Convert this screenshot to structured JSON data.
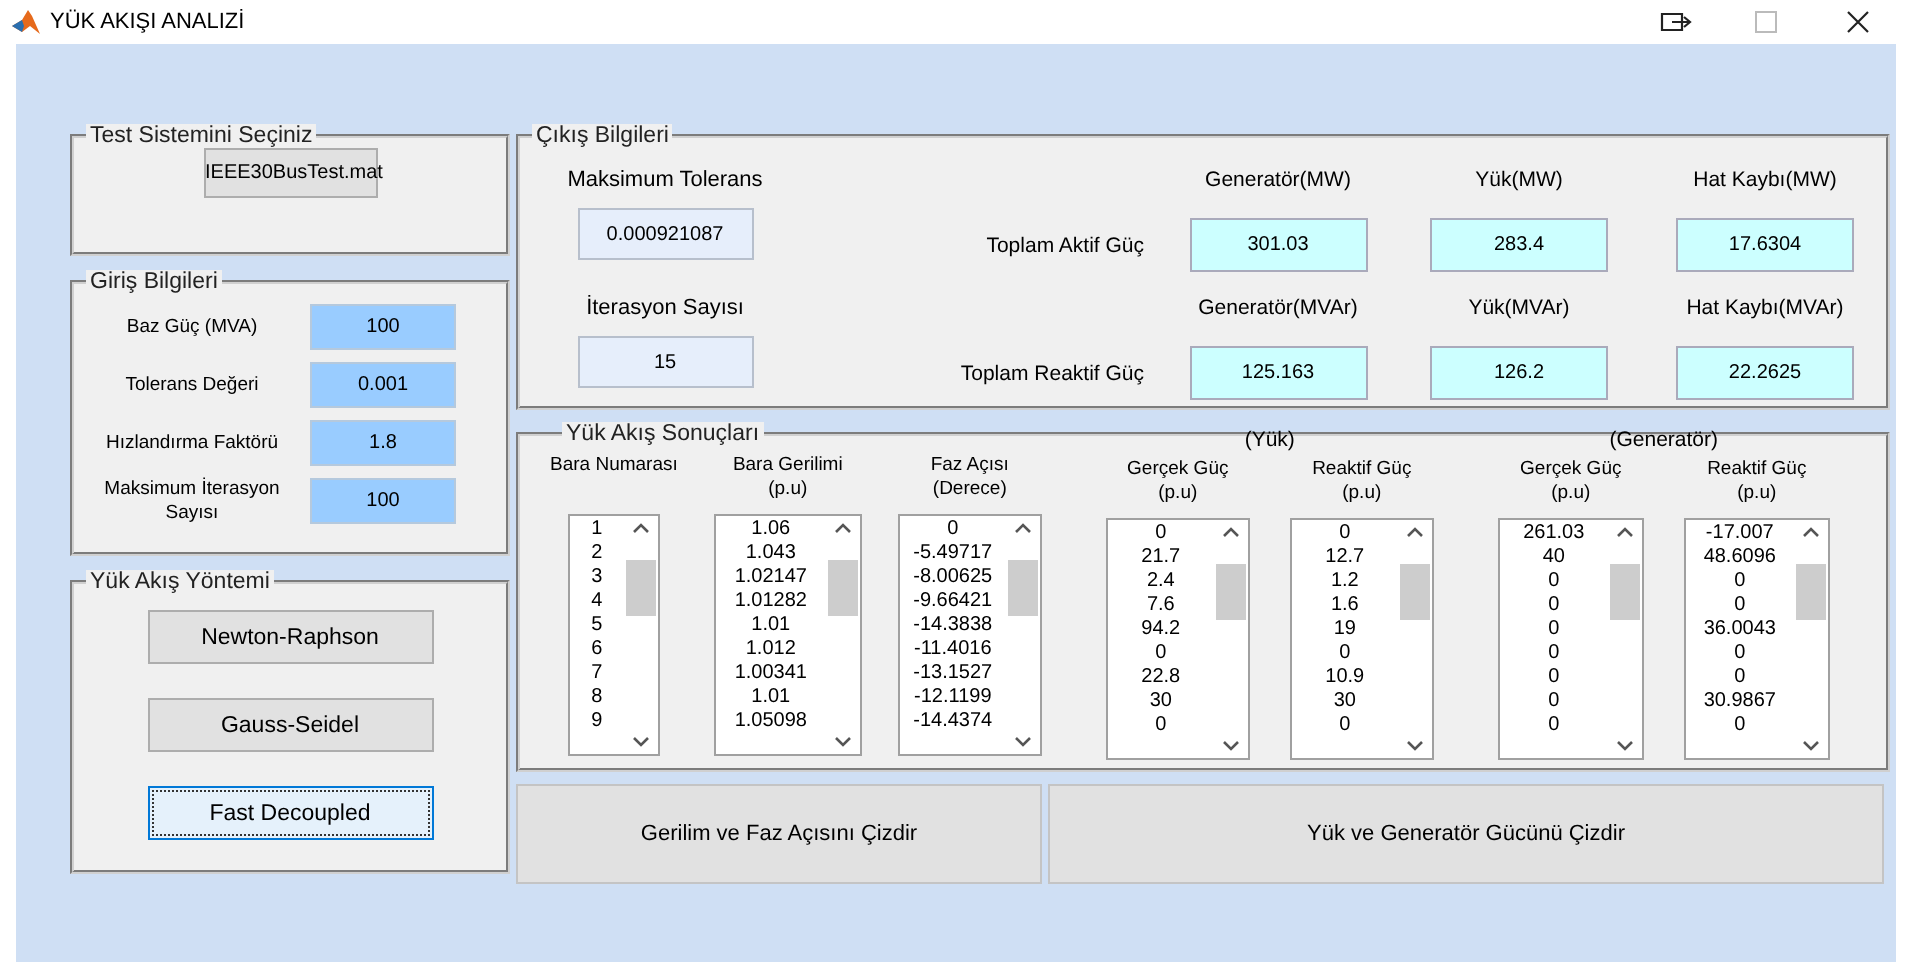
{
  "window": {
    "title": "YÜK AKIŞI ANALIZİ"
  },
  "test_system": {
    "title": "Test Sistemini Seçiniz",
    "button": "IEEE30BusTest.mat"
  },
  "inputs": {
    "title": "Giriş Bilgileri",
    "fields": [
      {
        "label": "Baz Güç (MVA)",
        "value": "100"
      },
      {
        "label": "Tolerans Değeri",
        "value": "0.001"
      },
      {
        "label": "Hızlandırma Faktörü",
        "value": "1.8"
      },
      {
        "label": "Maksimum İterasyon Sayısı",
        "value": "100"
      }
    ]
  },
  "method": {
    "title": "Yük Akış Yöntemi",
    "options": [
      {
        "label": "Newton-Raphson",
        "selected": false
      },
      {
        "label": "Gauss-Seidel",
        "selected": false
      },
      {
        "label": "Fast Decoupled",
        "selected": true
      }
    ]
  },
  "output": {
    "title": "Çıkış Bilgileri",
    "summary": [
      {
        "label": "Maksimum Tolerans",
        "value": "0.000921087"
      },
      {
        "label": "İterasyon Sayısı",
        "value": "15"
      }
    ],
    "rows": [
      {
        "label": "Toplam Aktif Güç",
        "cells": [
          {
            "header": "Generatör(MW)",
            "value": "301.03"
          },
          {
            "header": "Yük(MW)",
            "value": "283.4"
          },
          {
            "header": "Hat Kaybı(MW)",
            "value": "17.6304"
          }
        ]
      },
      {
        "label": "Toplam Reaktif Güç",
        "cells": [
          {
            "header": "Generatör(MVAr)",
            "value": "125.163"
          },
          {
            "header": "Yük(MVAr)",
            "value": "126.2"
          },
          {
            "header": "Hat Kaybı(MVAr)",
            "value": "22.2625"
          }
        ]
      }
    ]
  },
  "results": {
    "title": "Yük Akış Sonuçları",
    "sections": [
      {
        "lists": [
          {
            "header": "Bara Numarası",
            "values": [
              "1",
              "2",
              "3",
              "4",
              "5",
              "6",
              "7",
              "8",
              "9"
            ]
          },
          {
            "header": "Bara Gerilimi",
            "unit": "(p.u)",
            "values": [
              "1.06",
              "1.043",
              "1.02147",
              "1.01282",
              "1.01",
              "1.012",
              "1.00341",
              "1.01",
              "1.05098"
            ]
          },
          {
            "header": "Faz Açısı",
            "unit": "(Derece)",
            "values": [
              "0",
              "-5.49717",
              "-8.00625",
              "-9.66421",
              "-14.3838",
              "-11.4016",
              "-13.1527",
              "-12.1199",
              "-14.4374"
            ]
          }
        ]
      },
      {
        "group": "(Yük)",
        "lists": [
          {
            "header": "Gerçek Güç",
            "unit": "(p.u)",
            "values": [
              "0",
              "21.7",
              "2.4",
              "7.6",
              "94.2",
              "0",
              "22.8",
              "30",
              "0"
            ]
          },
          {
            "header": "Reaktif Güç",
            "unit": "(p.u)",
            "values": [
              "0",
              "12.7",
              "1.2",
              "1.6",
              "19",
              "0",
              "10.9",
              "30",
              "0"
            ]
          }
        ]
      },
      {
        "group": "(Generatör)",
        "lists": [
          {
            "header": "Gerçek Güç",
            "unit": "(p.u)",
            "values": [
              "261.03",
              "40",
              "0",
              "0",
              "0",
              "0",
              "0",
              "0",
              "0"
            ]
          },
          {
            "header": "Reaktif Güç",
            "unit": "(p.u)",
            "values": [
              "-17.007",
              "48.6096",
              "0",
              "0",
              "36.0043",
              "0",
              "0",
              "30.9867",
              "0"
            ]
          }
        ]
      }
    ]
  },
  "actions": [
    "Gerilim ve Faz Açısını Çizdir",
    "Yük ve Generatör Gücünü Çizdir"
  ]
}
